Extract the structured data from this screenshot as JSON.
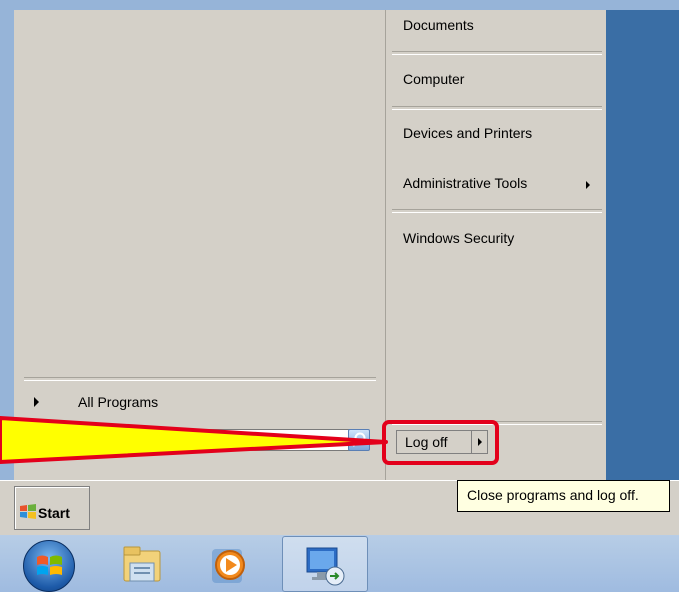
{
  "start_menu": {
    "left_pane": {
      "all_programs_label": "All Programs",
      "search_placeholder": ""
    },
    "right_pane": {
      "items": [
        {
          "label": "Documents"
        },
        {
          "label": "Computer"
        },
        {
          "label": "Devices and Printers"
        },
        {
          "label": "Administrative Tools"
        },
        {
          "label": "Windows Security"
        }
      ],
      "logoff_label": "Log off"
    }
  },
  "taskbar": {
    "start_label": "Start",
    "tooltip_text": "Close programs and log off.",
    "pinned": [
      "windows-orb-icon",
      "explorer-folder-icon",
      "media-player-icon",
      "remote-desktop-icon"
    ]
  },
  "colors": {
    "highlight": "#e3001b",
    "callout_fill": "#ffff00",
    "desktop": "#3a6ea5"
  }
}
